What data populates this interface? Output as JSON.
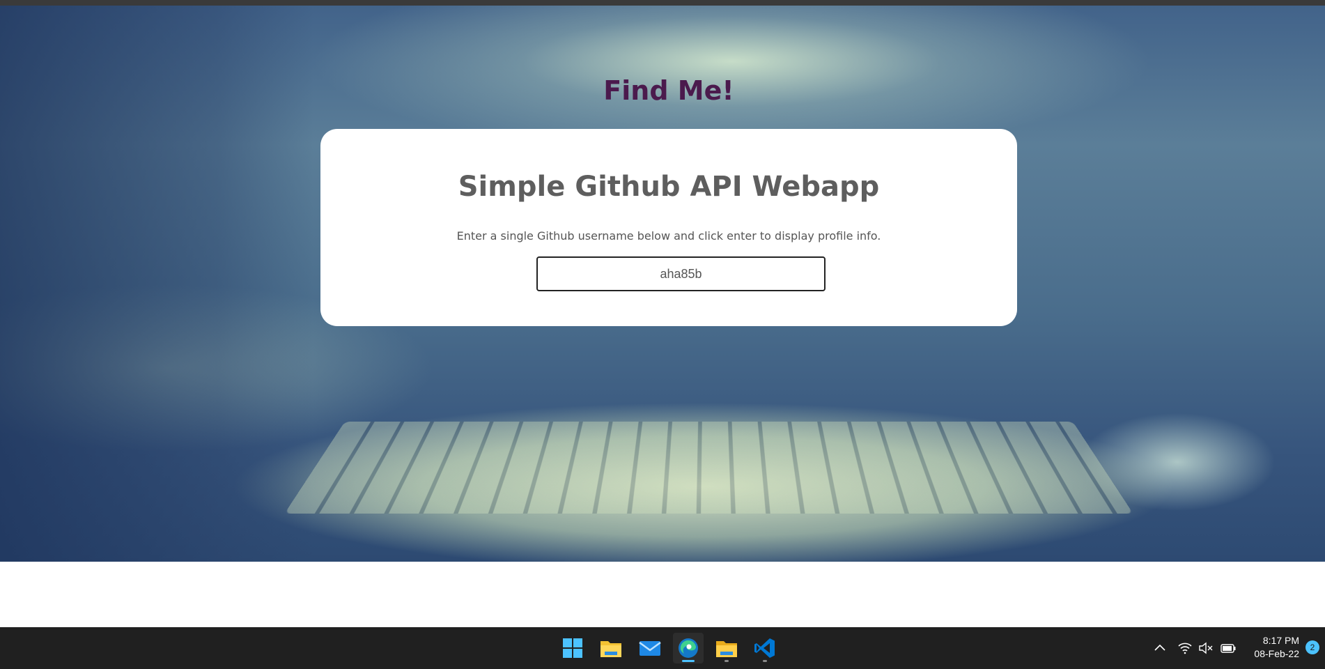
{
  "page": {
    "heading": "Find Me!",
    "card": {
      "title": "Simple Github API Webapp",
      "description": "Enter a single Github username below and click enter to display profile info.",
      "username_value": "aha85b"
    }
  },
  "taskbar": {
    "apps": [
      {
        "name": "start-icon"
      },
      {
        "name": "file-explorer-icon"
      },
      {
        "name": "mail-icon"
      },
      {
        "name": "edge-icon",
        "active": true
      },
      {
        "name": "folder-icon"
      },
      {
        "name": "vscode-icon"
      }
    ],
    "tray": {
      "time": "8:17 PM",
      "date": "08-Feb-22",
      "notification_count": "2",
      "icons": [
        "chevron-up-icon",
        "wifi-icon",
        "volume-muted-icon",
        "battery-icon"
      ]
    }
  },
  "colors": {
    "heading": "#4b1a4d",
    "card_title": "#5e5e5e",
    "taskbar": "#202020",
    "accent": "#4cc2ff"
  }
}
